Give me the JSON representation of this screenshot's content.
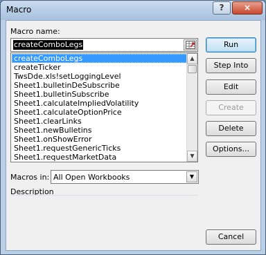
{
  "window": {
    "title": "Macro",
    "help_label": "?",
    "close_label": "×"
  },
  "form": {
    "macro_name_label": "Macro name:",
    "macro_name_value": "createComboLegs",
    "macros_in_label": "Macros in:",
    "macros_in_value": "All Open Workbooks",
    "description_label": "Description"
  },
  "macro_list": [
    "createComboLegs",
    "createTicker",
    "TwsDde.xls!setLoggingLevel",
    "Sheet1.bulletinDeSubscribe",
    "Sheet1.bulletinSubscribe",
    "Sheet1.calculateImpliedVolatility",
    "Sheet1.calculateOptionPrice",
    "Sheet1.clearLinks",
    "Sheet1.newBulletins",
    "Sheet1.onShowError",
    "Sheet1.requestGenericTicks",
    "Sheet1.requestMarketData"
  ],
  "selected_index": 0,
  "buttons": {
    "run": "Run",
    "step_into": "Step Into",
    "edit": "Edit",
    "create": "Create",
    "delete": "Delete",
    "options": "Options...",
    "cancel": "Cancel"
  },
  "icons": {
    "help": "help-icon",
    "close": "close-icon",
    "range_ref": "range-reference-icon",
    "scroll_up": "scroll-up-arrow-icon",
    "scroll_down": "scroll-down-arrow-icon",
    "dropdown": "chevron-down-icon"
  }
}
